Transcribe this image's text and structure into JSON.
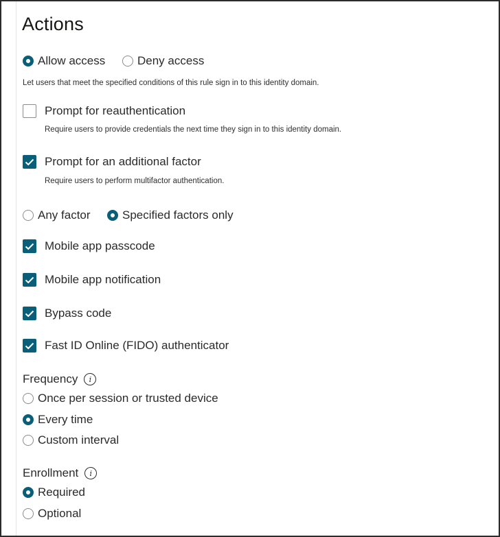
{
  "title": "Actions",
  "access": {
    "allow_label": "Allow access",
    "deny_label": "Deny access",
    "selected": "allow",
    "help": "Let users that meet the specified conditions of this rule sign in to this identity domain."
  },
  "reauth": {
    "label": "Prompt for reauthentication",
    "checked": false,
    "help": "Require users to provide credentials the next time they sign in to this identity domain."
  },
  "additional_factor": {
    "label": "Prompt for an additional factor",
    "checked": true,
    "help": "Require users to perform multifactor authentication."
  },
  "factor_scope": {
    "any_label": "Any factor",
    "specified_label": "Specified factors only",
    "selected": "specified"
  },
  "factors": [
    {
      "label": "Mobile app passcode",
      "checked": true
    },
    {
      "label": "Mobile app notification",
      "checked": true
    },
    {
      "label": "Bypass code",
      "checked": true
    },
    {
      "label": "Fast ID Online (FIDO) authenticator",
      "checked": true
    }
  ],
  "frequency": {
    "label": "Frequency",
    "info_icon": "i",
    "options": [
      "Once per session or trusted device",
      "Every time",
      "Custom interval"
    ],
    "selected": "Every time"
  },
  "enrollment": {
    "label": "Enrollment",
    "info_icon": "i",
    "options": [
      "Required",
      "Optional"
    ],
    "selected": "Required"
  },
  "colors": {
    "accent": "#0a5f78",
    "text": "#2a2a2a"
  }
}
